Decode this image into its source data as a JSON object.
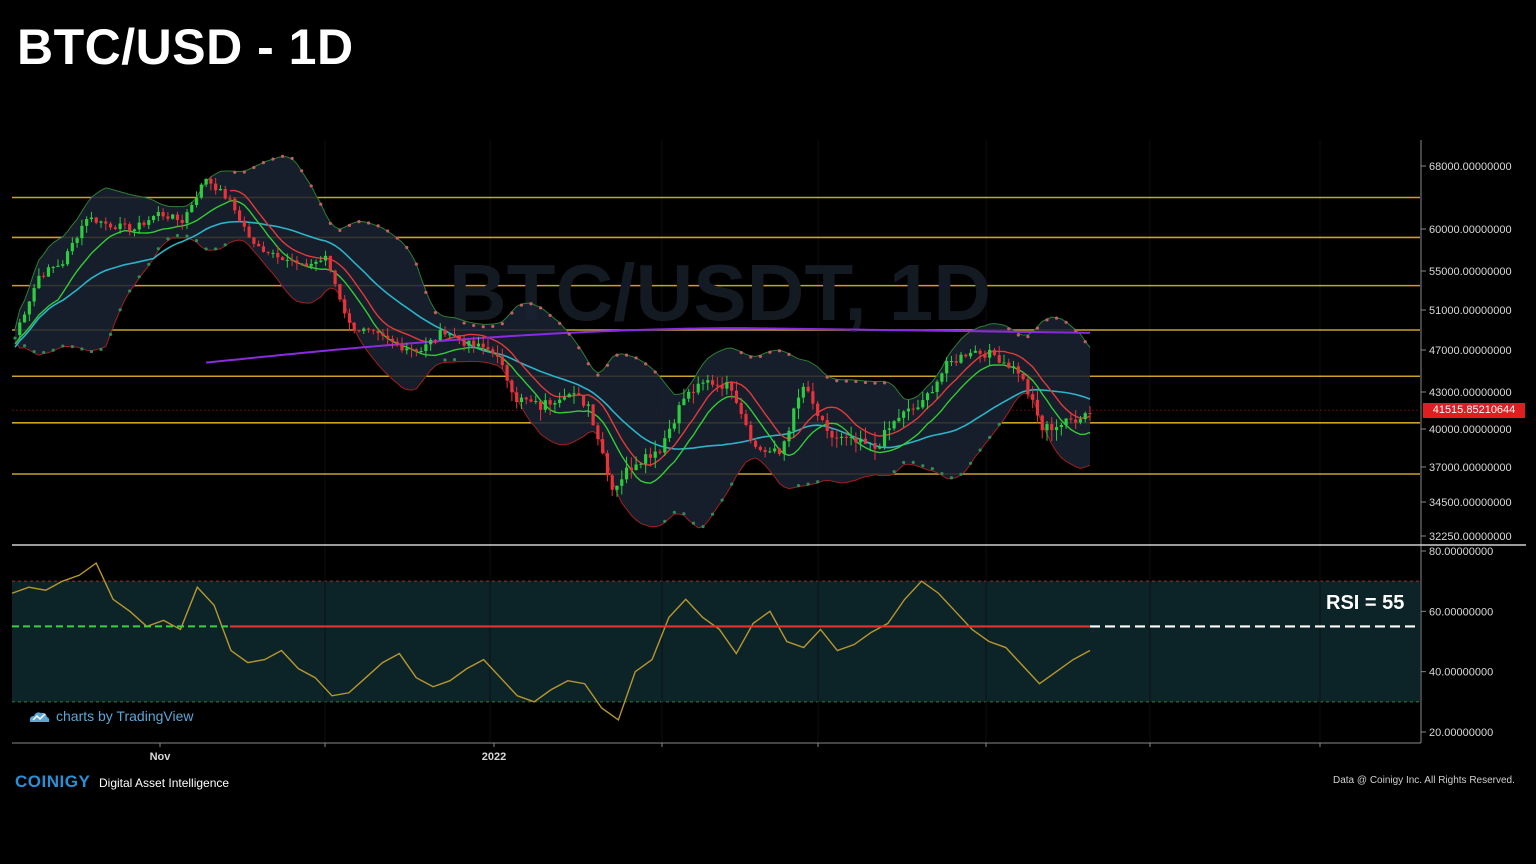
{
  "header": {
    "title": "BTC/USD - 1D"
  },
  "watermark": {
    "text": "BTC/USDT, 1D"
  },
  "footer": {
    "tradingview": "charts by TradingView",
    "brand": "COINIGY",
    "tagline": "Digital Asset Intelligence",
    "copyright": "Data @ Coinigy Inc.  All Rights Reserved."
  },
  "rsi_text": "RSI = 55",
  "last_price_label": "41515.85210644",
  "colors": {
    "bull": "#2ecc40",
    "bear": "#e8333b",
    "hline": "#c9a227",
    "ma_purple": "#8a2be2",
    "ma_cyan": "#2bb3c7",
    "ma_green": "#33cc33",
    "ma_red": "#e03b3b",
    "band_fill": "#1a2233",
    "rsi_line": "#b8962e",
    "rsi_bg": "#0c2428"
  },
  "chart_data": [
    {
      "type": "candlestick",
      "title": "BTC/USD - 1D",
      "y_ticks": [
        "68000.00000000",
        "60000.00000000",
        "55000.00000000",
        "51000.00000000",
        "47000.00000000",
        "43000.00000000",
        "40000.00000000",
        "37000.00000000",
        "34500.00000000",
        "32250.00000000"
      ],
      "x_ticks": [
        "Nov",
        "2022"
      ],
      "horizontal_levels": [
        64000,
        59000,
        53500,
        49000,
        44500,
        40500,
        36500
      ],
      "last_price": 41515.85,
      "close_path": [
        {
          "x": 0,
          "close": 48500
        },
        {
          "x": 5,
          "close": 54500
        },
        {
          "x": 10,
          "close": 56000
        },
        {
          "x": 15,
          "close": 61500
        },
        {
          "x": 20,
          "close": 60500
        },
        {
          "x": 25,
          "close": 60000
        },
        {
          "x": 30,
          "close": 62000
        },
        {
          "x": 35,
          "close": 61000
        },
        {
          "x": 40,
          "close": 66500
        },
        {
          "x": 45,
          "close": 63500
        },
        {
          "x": 50,
          "close": 58000
        },
        {
          "x": 55,
          "close": 57000
        },
        {
          "x": 60,
          "close": 55500
        },
        {
          "x": 65,
          "close": 56500
        },
        {
          "x": 70,
          "close": 49500
        },
        {
          "x": 75,
          "close": 48500
        },
        {
          "x": 80,
          "close": 47500
        },
        {
          "x": 85,
          "close": 47000
        },
        {
          "x": 90,
          "close": 49000
        },
        {
          "x": 95,
          "close": 47500
        },
        {
          "x": 100,
          "close": 47000
        },
        {
          "x": 105,
          "close": 42500
        },
        {
          "x": 110,
          "close": 41800
        },
        {
          "x": 115,
          "close": 43000
        },
        {
          "x": 120,
          "close": 42000
        },
        {
          "x": 125,
          "close": 35500
        },
        {
          "x": 130,
          "close": 37500
        },
        {
          "x": 135,
          "close": 38500
        },
        {
          "x": 140,
          "close": 42500
        },
        {
          "x": 145,
          "close": 44000
        },
        {
          "x": 150,
          "close": 43500
        },
        {
          "x": 155,
          "close": 38500
        },
        {
          "x": 160,
          "close": 38000
        },
        {
          "x": 165,
          "close": 43500
        },
        {
          "x": 170,
          "close": 39500
        },
        {
          "x": 175,
          "close": 39000
        },
        {
          "x": 180,
          "close": 38500
        },
        {
          "x": 185,
          "close": 41000
        },
        {
          "x": 190,
          "close": 42000
        },
        {
          "x": 195,
          "close": 45500
        },
        {
          "x": 200,
          "close": 47000
        },
        {
          "x": 205,
          "close": 46500
        },
        {
          "x": 210,
          "close": 45000
        },
        {
          "x": 215,
          "close": 40000
        },
        {
          "x": 220,
          "close": 40500
        },
        {
          "x": 225,
          "close": 41500
        }
      ]
    },
    {
      "type": "line",
      "title": "RSI",
      "y_ticks": [
        "80.00000000",
        "60.00000000",
        "40.00000000",
        "20.00000000"
      ],
      "ylim": [
        20,
        80
      ],
      "levels": [
        70,
        55,
        30
      ],
      "series": [
        {
          "values": [
            66,
            68,
            67,
            70,
            72,
            76,
            64,
            60,
            55,
            57,
            54,
            68,
            62,
            47,
            43,
            44,
            47,
            41,
            38,
            32,
            33,
            38,
            43,
            46,
            38,
            35,
            37,
            41,
            44,
            38,
            32,
            30,
            34,
            37,
            36,
            28,
            24,
            40,
            44,
            58,
            64,
            58,
            54,
            46,
            56,
            60,
            50,
            48,
            54,
            47,
            49,
            53,
            56,
            64,
            70,
            66,
            60,
            54,
            50,
            48,
            42,
            36,
            40,
            44,
            47
          ]
        }
      ]
    }
  ]
}
